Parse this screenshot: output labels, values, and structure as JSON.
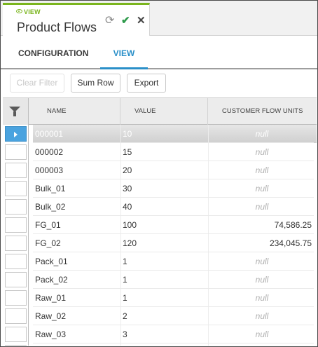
{
  "tab": {
    "badge": "VIEW",
    "title": "Product Flows"
  },
  "subtabs": [
    "CONFIGURATION",
    "VIEW"
  ],
  "toolbar": {
    "clear_filter": "Clear Filter",
    "sum_row": "Sum Row",
    "export": "Export"
  },
  "grid": {
    "columns": [
      "NAME",
      "VALUE",
      "CUSTOMER FLOW UNITS"
    ],
    "rows": [
      {
        "name": "000001",
        "value": "10",
        "units": "null"
      },
      {
        "name": "000002",
        "value": "15",
        "units": "null"
      },
      {
        "name": "000003",
        "value": "20",
        "units": "null"
      },
      {
        "name": "Bulk_01",
        "value": "30",
        "units": "null"
      },
      {
        "name": "Bulk_02",
        "value": "40",
        "units": "null"
      },
      {
        "name": "FG_01",
        "value": "100",
        "units": "74,586.25"
      },
      {
        "name": "FG_02",
        "value": "120",
        "units": "234,045.75"
      },
      {
        "name": "Pack_01",
        "value": "1",
        "units": "null"
      },
      {
        "name": "Pack_02",
        "value": "1",
        "units": "null"
      },
      {
        "name": "Raw_01",
        "value": "1",
        "units": "null"
      },
      {
        "name": "Raw_02",
        "value": "2",
        "units": "null"
      },
      {
        "name": "Raw_03",
        "value": "3",
        "units": "null"
      },
      {
        "name": "",
        "value": "",
        "units": ""
      }
    ],
    "current_row": 0
  },
  "colors": {
    "accent_green": "#7ab51d",
    "accent_blue": "#2a8fc8",
    "selected_blue": "#4aa3df"
  }
}
